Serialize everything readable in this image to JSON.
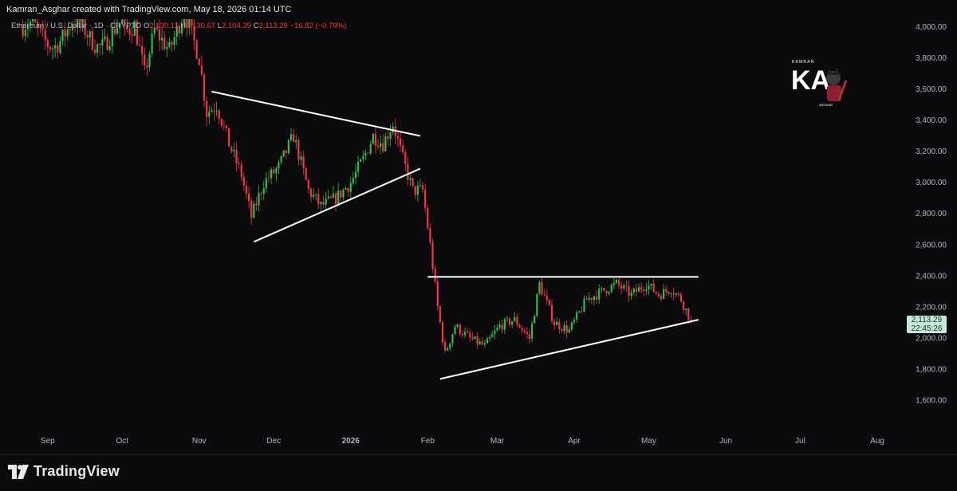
{
  "header": {
    "attribution": "Kamran_Asghar created with TradingView.com, May 18, 2026 01:14 UTC"
  },
  "legend": {
    "symbol": "Ethereum / U.S. Dollar · 1D · CRYPTO",
    "open_label": "O",
    "open": "2,130.11",
    "high_label": "H",
    "high": "2,130.67",
    "low_label": "L",
    "low": "2,104.39",
    "close_label": "C",
    "close": "2,113.29",
    "change": "−16.82 (−0.79%)"
  },
  "watermark": {
    "text_top": "KAMRAN",
    "letters": "KA",
    "text_bottom": "ASGHAR"
  },
  "price_badge": {
    "price": "2,113.29",
    "countdown": "22:45:26"
  },
  "footer": {
    "brand": "TradingView"
  },
  "colors": {
    "background": "#0b0b0d",
    "up": "#2ebd4e",
    "down": "#f23645",
    "trendline": "#ffffff",
    "badge": "#c7e8d8"
  },
  "chart_data": {
    "type": "candlestick",
    "title": "Ethereum / U.S. Dollar · 1D · CRYPTO",
    "y_ticks": [
      "4,000.00",
      "3,800.00",
      "3,600.00",
      "3,400.00",
      "3,200.00",
      "3,000.00",
      "2,800.00",
      "2,600.00",
      "2,400.00",
      "2,200.00",
      "2,000.00",
      "1,800.00",
      "1,600.00"
    ],
    "y_tick_values": [
      4000,
      3800,
      3600,
      3400,
      3200,
      3000,
      2800,
      2600,
      2400,
      2200,
      2000,
      1800,
      1600
    ],
    "x_ticks": [
      "Sep",
      "Oct",
      "Nov",
      "Dec",
      "2026",
      "Feb",
      "Mar",
      "Apr",
      "May",
      "Jun",
      "Jul",
      "Aug"
    ],
    "x_tick_dates": [
      "2025-09-01",
      "2025-10-01",
      "2025-11-01",
      "2025-12-01",
      "2026-01-01",
      "2026-02-01",
      "2026-03-01",
      "2026-04-01",
      "2026-05-01",
      "2026-06-01",
      "2026-07-01",
      "2026-08-01"
    ],
    "ylim": [
      1450,
      4050
    ],
    "xlim": [
      "2025-08-16",
      "2026-08-10"
    ],
    "grid": false,
    "last_close": 2113.29,
    "closes_anchor_dates": [
      "2025-10-01",
      "2025-10-06",
      "2025-10-10",
      "2025-10-14",
      "2025-10-20",
      "2025-10-26",
      "2025-10-30",
      "2025-11-01",
      "2025-11-04",
      "2025-11-08",
      "2025-11-13",
      "2025-11-18",
      "2025-11-22",
      "2025-11-27",
      "2025-12-03",
      "2025-12-09",
      "2025-12-15",
      "2025-12-20",
      "2025-12-26",
      "2026-01-01",
      "2026-01-06",
      "2026-01-10",
      "2026-01-14",
      "2026-01-18",
      "2026-01-22",
      "2026-01-26",
      "2026-01-30",
      "2026-02-02",
      "2026-02-05",
      "2026-02-08",
      "2026-02-12",
      "2026-02-18",
      "2026-02-24",
      "2026-03-02",
      "2026-03-08",
      "2026-03-14",
      "2026-03-18",
      "2026-03-24",
      "2026-03-30",
      "2026-04-06",
      "2026-04-12",
      "2026-04-18",
      "2026-04-24",
      "2026-04-30",
      "2026-05-05",
      "2026-05-10",
      "2026-05-14",
      "2026-05-18"
    ],
    "closes_anchor_values": [
      3950,
      4010,
      3700,
      3980,
      3850,
      4100,
      3900,
      3800,
      3450,
      3500,
      3250,
      3050,
      2780,
      3000,
      3100,
      3300,
      2950,
      2850,
      2900,
      3000,
      3150,
      3300,
      3250,
      3380,
      3150,
      2950,
      2950,
      2600,
      2200,
      1900,
      2080,
      2000,
      1950,
      2080,
      2120,
      2000,
      2350,
      2100,
      2050,
      2250,
      2300,
      2350,
      2280,
      2350,
      2280,
      2320,
      2250,
      2113
    ],
    "trendlines": [
      {
        "name": "triangle-upper",
        "from": {
          "date": "2025-11-06",
          "value": 3585
        },
        "to": {
          "date": "2026-01-29",
          "value": 3300
        }
      },
      {
        "name": "triangle-lower",
        "from": {
          "date": "2025-11-23",
          "value": 2620
        },
        "to": {
          "date": "2026-01-29",
          "value": 3090
        }
      },
      {
        "name": "resistance",
        "from": {
          "date": "2026-02-01",
          "value": 2395
        },
        "to": {
          "date": "2026-05-21",
          "value": 2395
        }
      },
      {
        "name": "rising-support",
        "from": {
          "date": "2026-02-06",
          "value": 1740
        },
        "to": {
          "date": "2026-05-21",
          "value": 2120
        }
      }
    ]
  }
}
